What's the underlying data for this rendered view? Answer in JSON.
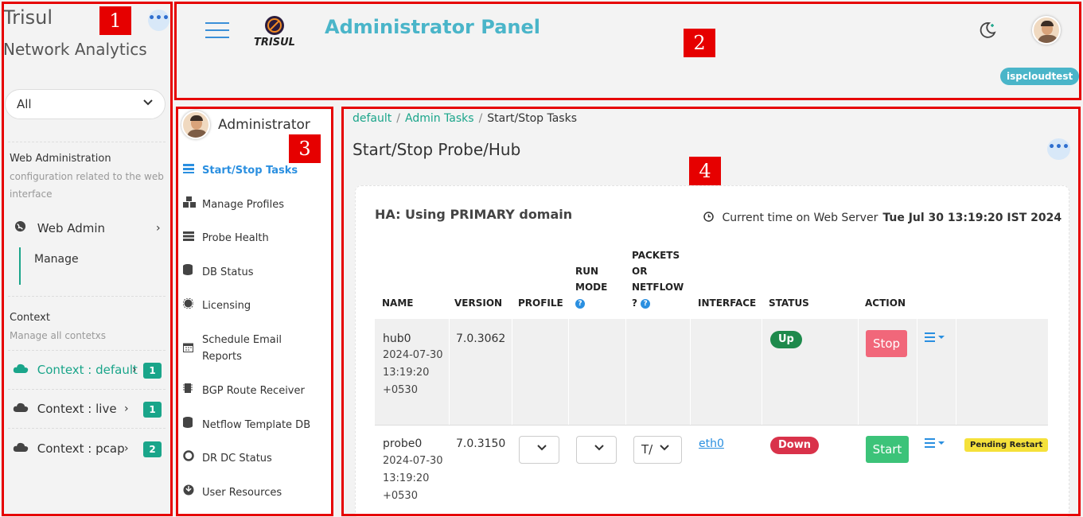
{
  "sidebar": {
    "brand_line1": "Trisul",
    "brand_line2": "Network Analytics",
    "more_label": "•••",
    "context_filter": "All",
    "web_admin_section": {
      "title": "Web Administration",
      "desc": "configuration related to the web interface"
    },
    "web_admin_item": "Web Admin",
    "manage_item": "Manage",
    "context_section": {
      "title": "Context",
      "desc": "Manage all contetxs"
    },
    "contexts": [
      {
        "label": "Context : default",
        "count": "1"
      },
      {
        "label": "Context : live",
        "count": "1"
      },
      {
        "label": "Context : pcap",
        "count": "2"
      }
    ]
  },
  "header": {
    "logo_text": "TRISUL",
    "title": "Administrator Panel",
    "user_badge": "ispcloudtest"
  },
  "adminnav": {
    "user": "Administrator",
    "items": [
      {
        "label": "Start/Stop Tasks",
        "icon": "list-icon"
      },
      {
        "label": "Manage Profiles",
        "icon": "cubes-icon"
      },
      {
        "label": "Probe Health",
        "icon": "server-icon"
      },
      {
        "label": "DB Status",
        "icon": "database-icon"
      },
      {
        "label": "Licensing",
        "icon": "certificate-icon"
      },
      {
        "label": "Schedule Email Reports",
        "icon": "calendar-icon"
      },
      {
        "label": "BGP Route Receiver",
        "icon": "chip-icon"
      },
      {
        "label": "Netflow Template DB",
        "icon": "database-icon"
      },
      {
        "label": "DR DC Status",
        "icon": "lifering-icon"
      },
      {
        "label": "User Resources",
        "icon": "rebel-icon"
      }
    ]
  },
  "main": {
    "breadcrumb": [
      "default",
      "Admin Tasks",
      "Start/Stop Tasks"
    ],
    "title": "Start/Stop Probe/Hub",
    "more_label": "•••",
    "ha_title": "HA: Using PRIMARY domain",
    "time_label": "Current time on Web Server",
    "time_value": "Tue Jul 30 13:19:20 IST 2024",
    "columns": {
      "name": "NAME",
      "version": "VERSION",
      "profile": "PROFILE",
      "run_mode_1": "RUN",
      "run_mode_2": "MODE",
      "packets_1": "PACKETS",
      "packets_2": "OR",
      "packets_3": "NETFLOW",
      "packets_4": "?",
      "interface": "INTERFACE",
      "status": "STATUS",
      "action": "ACTION"
    },
    "help_glyph": "?",
    "rows": [
      {
        "name": "hub0",
        "date": "2024-07-30",
        "time": "13:19:20",
        "tz": "+0530",
        "version": "7.0.3062",
        "interface": "",
        "status": "Up",
        "action": "Stop",
        "note": ""
      },
      {
        "name": "probe0",
        "date": "2024-07-30",
        "time": "13:19:20",
        "tz": "+0530",
        "version": "7.0.3150",
        "packets_value": "T/",
        "interface": "eth0",
        "status": "Down",
        "action": "Start",
        "note": "Pending Restart"
      }
    ]
  },
  "callouts": [
    "1",
    "2",
    "3",
    "4"
  ],
  "colors": {
    "accent": "#4ab5c9",
    "teal": "#1aa58a",
    "highlight": "#e60000",
    "link": "#2a8fe0"
  }
}
